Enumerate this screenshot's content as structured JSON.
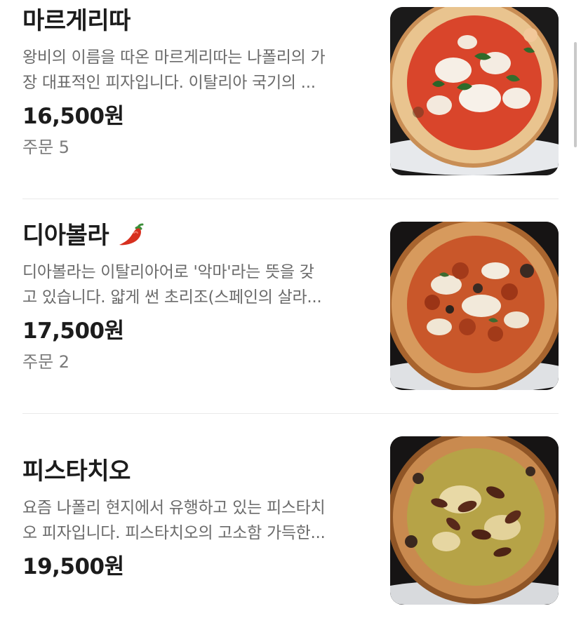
{
  "menu": {
    "items": [
      {
        "name": "마르게리따",
        "desc_line1": "왕비의 이름을 따온 마르게리따는 나폴리의 가",
        "desc_line2": "장 대표적인 피자입니다. 이탈리아 국기의 ...",
        "price": "16,500원",
        "orders": "주문 5",
        "image_icon": "margherita-pizza-photo"
      },
      {
        "name": "디아볼라",
        "badge_icon": "chili-pepper-icon",
        "desc_line1": "디아볼라는 이탈리아어로 '악마'라는 뜻을 갖",
        "desc_line2": "고 있습니다. 얇게 썬 초리조(스페인의 살라...",
        "price": "17,500원",
        "orders": "주문 2",
        "image_icon": "diavola-pizza-photo"
      },
      {
        "name": "피스타치오",
        "desc_line1": "요즘 나폴리 현지에서 유행하고 있는 피스타치",
        "desc_line2": "오 피자입니다. 피스타치오의 고소함 가득한...",
        "price": "19,500원",
        "image_icon": "pistachio-pizza-photo"
      }
    ]
  },
  "colors": {
    "title": "#1c1c1c",
    "description": "#6b6b6b",
    "orders": "#7a7a7a",
    "divider": "#e9e9e9",
    "chili": "#d7301f"
  }
}
